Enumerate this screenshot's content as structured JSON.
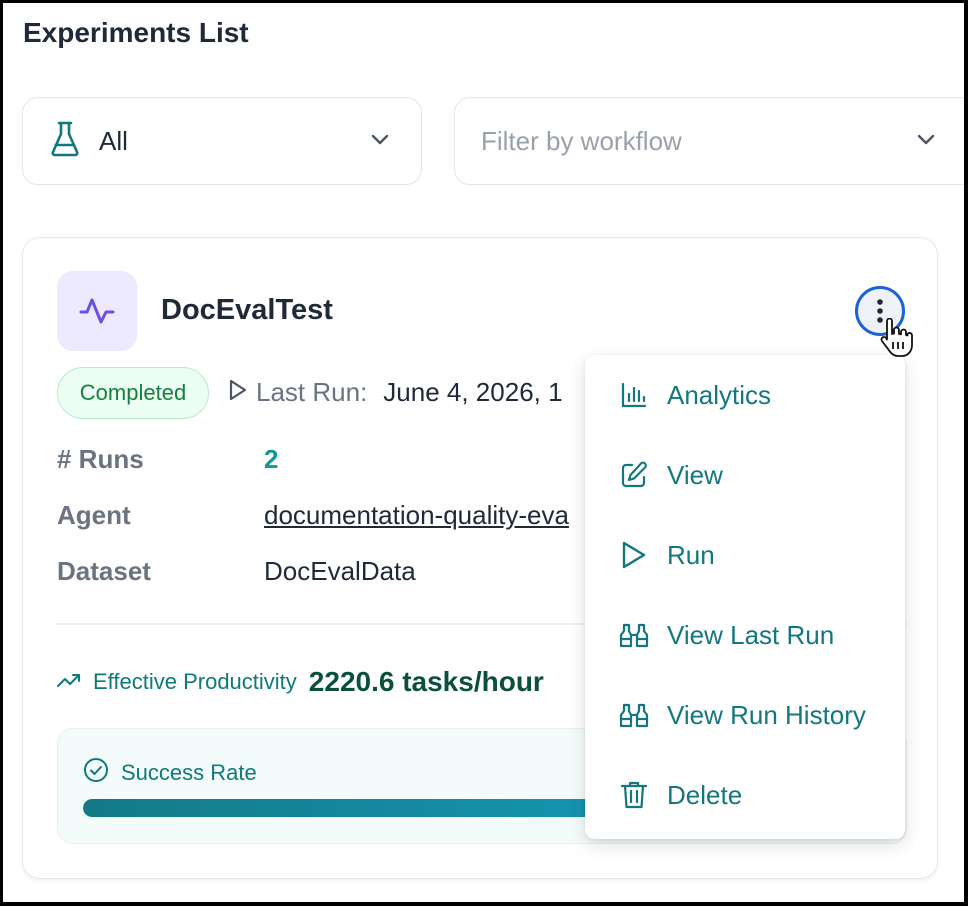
{
  "page": {
    "title": "Experiments List"
  },
  "filters": {
    "status": {
      "selected": "All",
      "icon": "flask-icon"
    },
    "workflow": {
      "placeholder": "Filter by workflow"
    }
  },
  "experiment": {
    "name": "DocEvalTest",
    "icon": "activity-pulse-icon",
    "status": "Completed",
    "last_run_label": "Last Run:",
    "last_run_value": "June 4, 2026, 1",
    "fields": {
      "runs_label": "# Runs",
      "runs_value": "2",
      "agent_label": "Agent",
      "agent_value": "documentation-quality-eva",
      "dataset_label": "Dataset",
      "dataset_value": "DocEvalData"
    },
    "productivity": {
      "label": "Effective Productivity",
      "value": "2220.6 tasks/hour"
    },
    "success_rate": {
      "label": "Success Rate",
      "fill_percent": 100
    }
  },
  "menu": {
    "items": [
      {
        "label": "Analytics",
        "icon": "bar-chart-icon"
      },
      {
        "label": "View",
        "icon": "edit-icon"
      },
      {
        "label": "Run",
        "icon": "play-icon"
      },
      {
        "label": "View Last Run",
        "icon": "binoculars-icon"
      },
      {
        "label": "View Run History",
        "icon": "binoculars-icon"
      },
      {
        "label": "Delete",
        "icon": "trash-icon"
      }
    ]
  },
  "colors": {
    "accent_teal": "#13777f",
    "status_green": "#16803c",
    "focus_blue": "#1d63d8",
    "icon_purple": "#7c5cf0"
  }
}
